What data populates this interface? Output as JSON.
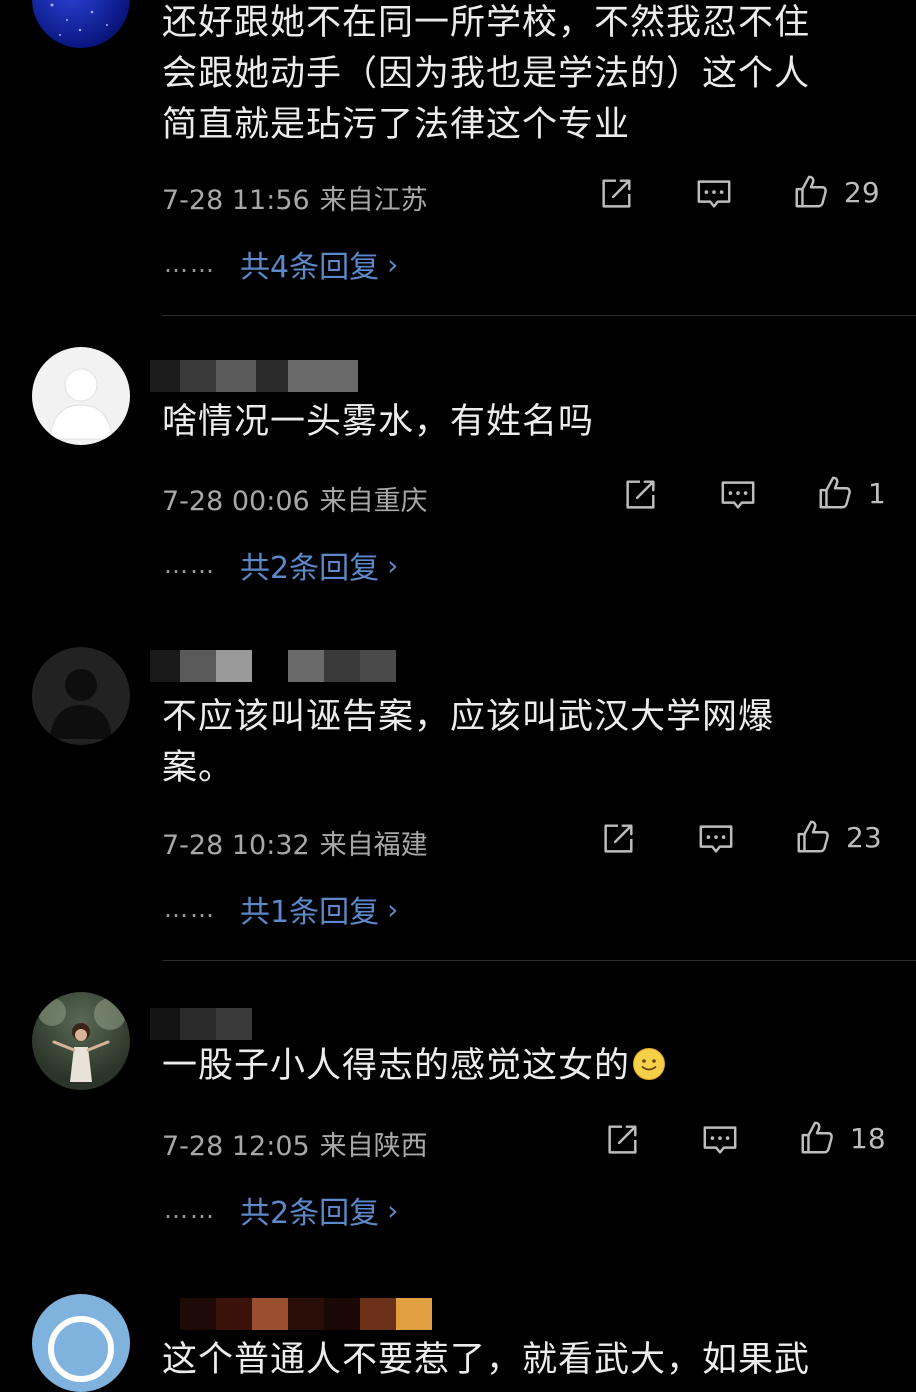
{
  "comments": [
    {
      "lines": [
        "还好跟她不在同一所学校，不然我忍不住",
        "会跟她动手（因为我也是学法的）这个人",
        "简直就是玷污了法律这个专业"
      ],
      "time": "7-28 11:56",
      "location": "来自江苏",
      "likes": "29",
      "replies": "共4条回复"
    },
    {
      "lines": [
        "啥情况一头雾水，有姓名吗"
      ],
      "time": "7-28 00:06",
      "location": "来自重庆",
      "likes": "1",
      "replies": "共2条回复"
    },
    {
      "lines": [
        "不应该叫诬告案，应该叫武汉大学网爆",
        "案。"
      ],
      "time": "7-28 10:32",
      "location": "来自福建",
      "likes": "23",
      "replies": "共1条回复"
    },
    {
      "lines": [
        "一股子小人得志的感觉这女的"
      ],
      "time": "7-28 12:05",
      "location": "来自陕西",
      "likes": "18",
      "replies": "共2条回复"
    },
    {
      "lines": [
        "这个普通人不要惹了，就看武大，如果武"
      ]
    }
  ],
  "ui": {
    "dots": "……",
    "chevron": "›"
  },
  "icons": [
    "share-icon",
    "comment-icon",
    "like-icon",
    "smile-emoji-icon",
    "default-avatar-icon"
  ],
  "colors": {
    "background": "#000000",
    "text": "#ececec",
    "meta": "#a8a8a8",
    "link": "#5c89c9"
  }
}
